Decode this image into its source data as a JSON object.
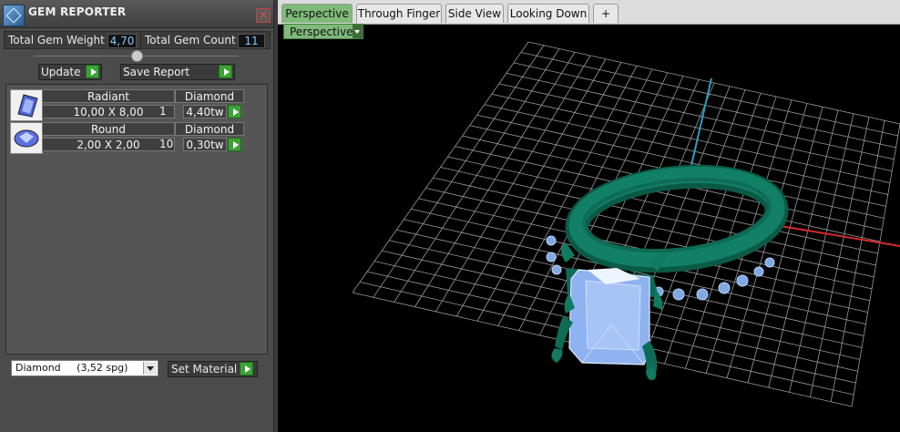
{
  "panel": {
    "title": "GEM REPORTER",
    "close_label": "×",
    "total_weight_label": "Total Gem Weight",
    "total_weight_value": "4,70",
    "total_count_label": "Total Gem Count",
    "total_count_value": "11",
    "update_label": "Update",
    "save_report_label": "Save Report",
    "gems": [
      {
        "cut": "Radiant",
        "material": "Diamond",
        "size": "10,00 X 8,00",
        "count": "1",
        "weight": "4,40tw",
        "icon": "radiant-gem-icon"
      },
      {
        "cut": "Round",
        "material": "Diamond",
        "size": "2,00 X 2,00",
        "count": "10",
        "weight": "0,30tw",
        "icon": "round-gem-icon"
      }
    ],
    "material_select_value": "Diamond     (3,52 spg)",
    "set_material_label": "Set Material"
  },
  "viewport": {
    "tabs": [
      {
        "label": "Perspective",
        "active": true
      },
      {
        "label": "Through Finger",
        "active": false
      },
      {
        "label": "Side View",
        "active": false
      },
      {
        "label": "Looking Down",
        "active": false
      }
    ],
    "add_tab_label": "+",
    "view_mode": "Perspective"
  },
  "colors": {
    "accent_green": "#7fba7a",
    "action_green": "#3ba336",
    "value_blue": "#7fc7ff",
    "metal_green": "#0e6b55",
    "gem_blue": "#8fb3f0",
    "axis_red": "#d42a2a",
    "axis_cyan": "#2a9fc8"
  }
}
